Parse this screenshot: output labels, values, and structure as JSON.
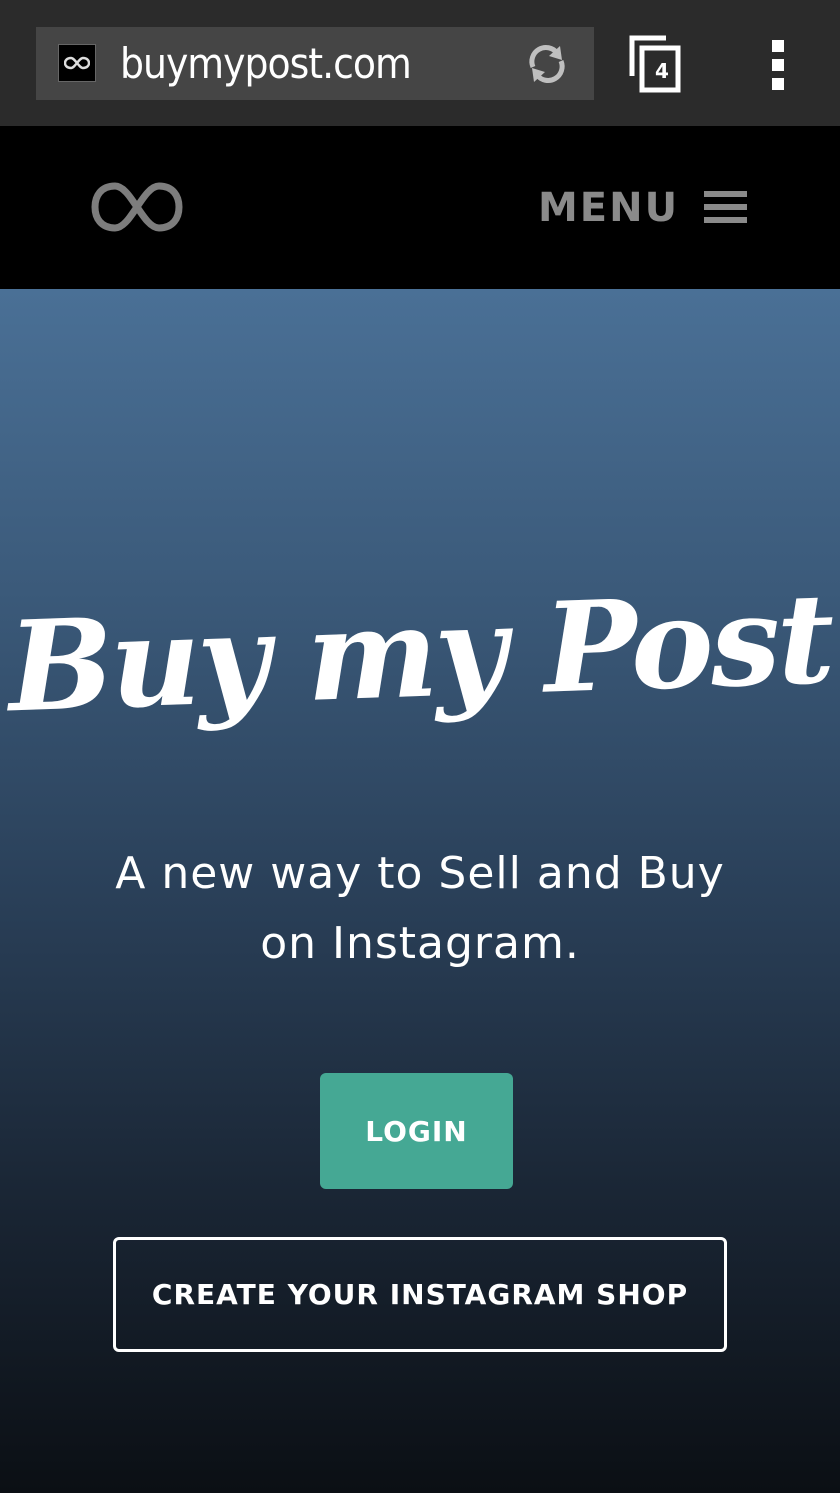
{
  "browser": {
    "url": "buymypost.com",
    "tab_count": "4",
    "favicon": "infinity-icon",
    "reload_icon": "reload-icon",
    "menu_icon": "overflow-menu-icon"
  },
  "nav": {
    "logo": "infinity-logo",
    "menu_label": "MENU",
    "menu_icon": "hamburger-icon"
  },
  "hero": {
    "title": "Buy my Post",
    "subtitle": "A new way to Sell and Buy on Instagram.",
    "login_label": "LOGIN",
    "create_shop_label": "CREATE YOUR INSTAGRAM SHOP"
  },
  "colors": {
    "accent": "#45a894",
    "chrome": "#2b2b2b",
    "hero_top": "#4a7096",
    "hero_bottom": "#0b0f14"
  }
}
